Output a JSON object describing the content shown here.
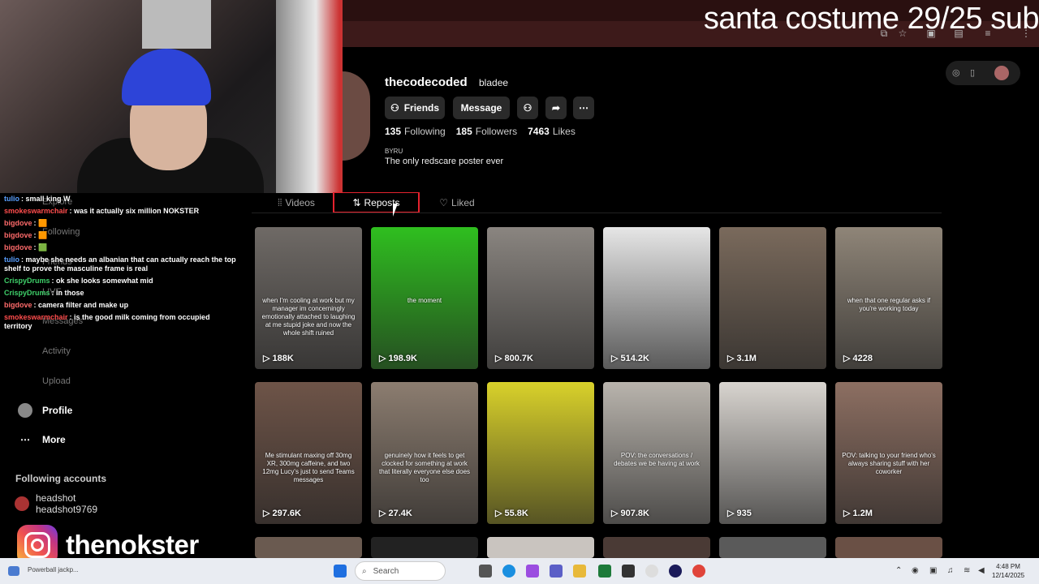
{
  "stream_overlay": {
    "title": "santa costume 29/25 sub",
    "instagram_handle": "thenokster"
  },
  "chat": [
    {
      "user": "tulio",
      "text": "small king W",
      "color": "#5aa0ff"
    },
    {
      "user": "smokeswarmchair",
      "text": "was it actually six million NOKSTER",
      "color": "#ff4d4d"
    },
    {
      "user": "bigdove",
      "text": "🟧",
      "color": "#ff6b6b"
    },
    {
      "user": "bigdove",
      "text": "🟧",
      "color": "#ff6b6b"
    },
    {
      "user": "bigdove",
      "text": "🟩",
      "color": "#ff6b6b"
    },
    {
      "user": "tulio",
      "text": "maybe she needs an albanian that can actually reach the top shelf to prove the masculine frame is real",
      "color": "#5aa0ff"
    },
    {
      "user": "CrispyDrums",
      "text": "ok she looks somewhat mid",
      "color": "#3fd16a"
    },
    {
      "user": "CrispyDrums",
      "text": "in those",
      "color": "#3fd16a"
    },
    {
      "user": "bigdove",
      "text": "camera filter and make up",
      "color": "#ff6b6b"
    },
    {
      "user": "smokeswarmchair",
      "text": "is the good milk coming from occupied territory",
      "color": "#ff4d4d"
    }
  ],
  "ghost_nav": [
    "Explore",
    "Following",
    "Friends",
    "LIVE",
    "Messages",
    "Activity",
    "Upload"
  ],
  "sidebar": {
    "profile_label": "Profile",
    "more_label": "More",
    "following_title": "Following accounts",
    "account": {
      "name": "headshot",
      "handle": "headshot9769"
    }
  },
  "profile": {
    "username": "thecodecoded",
    "nickname": "bladee",
    "friends_label": "Friends",
    "message_label": "Message",
    "following_count": "135",
    "following_label": "Following",
    "followers_count": "185",
    "followers_label": "Followers",
    "likes_count": "7463",
    "likes_label": "Likes",
    "bio_label": "BYRU",
    "bio": "The only redscare poster ever"
  },
  "tabs": {
    "videos": "Videos",
    "reposts": "Reposts",
    "liked": "Liked"
  },
  "videos": [
    {
      "views": "188K",
      "caption": "when I'm cooling at work but my manager im concerningly emotionally attached to laughing at me stupid joke and now the whole shift ruined",
      "bg": "#6f6a66"
    },
    {
      "views": "198.9K",
      "caption": "the moment",
      "bg": "#2fbf1f"
    },
    {
      "views": "800.7K",
      "caption": "",
      "bg": "#8a8580"
    },
    {
      "views": "514.2K",
      "caption": "",
      "bg": "#e6e6e6"
    },
    {
      "views": "3.1M",
      "caption": "",
      "bg": "#7a6a5c"
    },
    {
      "views": "4228",
      "caption": "when that one regular asks if you're working today",
      "bg": "#8f8578"
    },
    {
      "views": "297.6K",
      "caption": "Me stimulant maxing off 30mg XR, 300mg caffeine, and two 12mg Lucy's just to send Teams messages",
      "bg": "#6e5448"
    },
    {
      "views": "27.4K",
      "caption": "genuinely how it feels to get clocked for something at work that literally everyone else does too",
      "bg": "#8c7d70"
    },
    {
      "views": "55.8K",
      "caption": "",
      "bg": "#d9d12a"
    },
    {
      "views": "907.8K",
      "caption": "POV: the conversations / debates we be having at work",
      "bg": "#b9b4ad"
    },
    {
      "views": "935",
      "caption": "",
      "bg": "#d8d4cf"
    },
    {
      "views": "1.2M",
      "caption": "POV: talking to your friend who's always sharing stuff with her coworker",
      "bg": "#8d6f62"
    }
  ],
  "taskbar": {
    "news": "Powerball jackp...",
    "search_placeholder": "Search",
    "time": "4:48 PM",
    "date": "12/14/2025"
  }
}
